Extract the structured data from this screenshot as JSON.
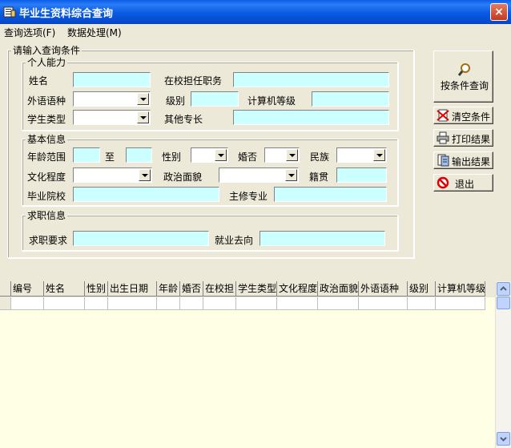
{
  "window": {
    "title": "毕业生资料综合查询",
    "close": "×"
  },
  "menu": {
    "items": [
      {
        "label": "查询选项(F)"
      },
      {
        "label": "数据处理(M)"
      }
    ]
  },
  "conditions": {
    "group_title": "请输入查询条件",
    "personal": {
      "title": "个人能力",
      "name": "姓名",
      "position": "在校担任职务",
      "language": "外语语种",
      "level": "级别",
      "computer_level": "计算机等级",
      "student_type": "学生类型",
      "other_skills": "其他专长"
    },
    "basic": {
      "title": "基本信息",
      "age_range": "年龄范围",
      "to": "至",
      "gender": "性别",
      "married": "婚否",
      "ethnicity": "民族",
      "education": "文化程度",
      "political": "政治面貌",
      "native_place": "籍贯",
      "school": "毕业院校",
      "major": "主修专业"
    },
    "job": {
      "title": "求职信息",
      "requirement": "求职要求",
      "destination": "就业去向"
    }
  },
  "buttons": {
    "query": "按条件查询",
    "clear": "清空条件",
    "print": "打印结果",
    "export": "输出结果",
    "exit": "退出"
  },
  "grid": {
    "columns": [
      "编号",
      "姓名",
      "性别",
      "出生日期",
      "年龄",
      "婚否",
      "在校担",
      "学生类型",
      "文化程度",
      "政治面貌",
      "外语语种",
      "级别",
      "计算机等级"
    ]
  },
  "colors": {
    "title_bar": "#0a5ee8",
    "field_bg": "#ccffff",
    "grid_bg": "#ffffe6",
    "window_bg": "#ece9d8"
  }
}
